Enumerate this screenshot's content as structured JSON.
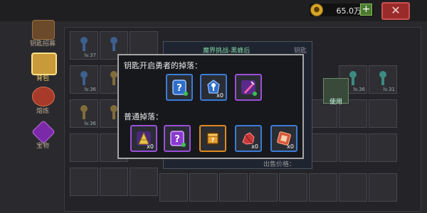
{
  "topbar": {
    "currency_amount": "65.0万",
    "plus_label": "+",
    "close_label": "✕"
  },
  "sidebar": {
    "items": [
      {
        "label": "钥匙招募"
      },
      {
        "label": "背包"
      },
      {
        "label": "熔炼"
      },
      {
        "label": "宝物"
      }
    ]
  },
  "background_panel": {
    "title": "魔界挑战-黑蜂后",
    "level_badge": "钥匙",
    "sell_label": "出售价格：",
    "use_button": "使用",
    "use_item_level": "lv.31",
    "slot_levels": [
      "lv.37",
      "lv.36",
      "lv.36",
      "lv.36",
      "lv.31"
    ]
  },
  "popup": {
    "title": "钥匙开启勇者的掉落：",
    "brave_drops": [
      {
        "icon": "mystery-box-icon",
        "quantity": ""
      },
      {
        "icon": "blue-key-icon",
        "quantity": "x0"
      },
      {
        "icon": "pink-sword-icon",
        "quantity": ""
      }
    ],
    "normal_title": "普通掉落：",
    "normal_drops": [
      {
        "icon": "gold-cone-icon",
        "quantity": "x0"
      },
      {
        "icon": "mystery-box-icon",
        "quantity": ""
      },
      {
        "icon": "gold-chest-icon",
        "quantity": ""
      },
      {
        "icon": "red-ore-icon",
        "quantity": "x0"
      },
      {
        "icon": "copper-ore-icon",
        "quantity": "x0"
      }
    ]
  },
  "colors": {
    "blue_rarity": "#3b7bd8",
    "purple_rarity": "#9b4fd8",
    "orange_rarity": "#e08a1e"
  }
}
